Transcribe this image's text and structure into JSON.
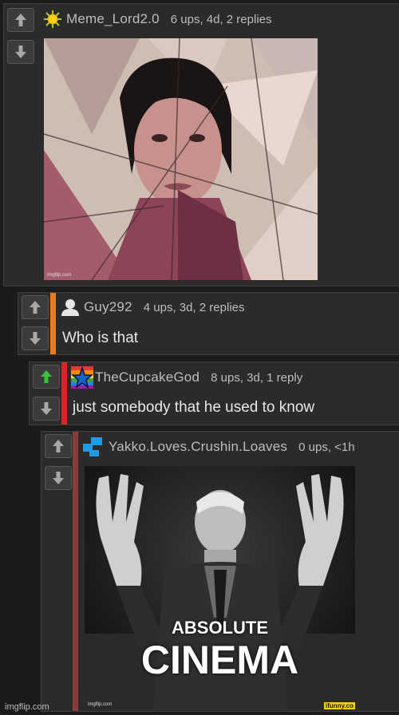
{
  "comments": [
    {
      "username": "Meme_Lord2.0",
      "meta": "6 ups, 4d, 2 replies",
      "avatar": "sun-icon",
      "image_watermark": "imgflip.com"
    },
    {
      "username": "Guy292",
      "meta": "4 ups, 3d, 2 replies",
      "text": "Who is that",
      "avatar": "user-silhouette-icon",
      "accent": "#f07b16"
    },
    {
      "username": "TheCupcakeGod",
      "meta": "8 ups, 3d, 1 reply",
      "text": "just somebody that he used to know",
      "avatar": "rainbow-star-icon",
      "accent": "#d62626",
      "upvoted": true
    },
    {
      "username": "Yakko.Loves.Crushin.Loaves",
      "meta": "0 ups, <1h",
      "avatar": "blue-pixel-icon",
      "accent": "#8a3b3b",
      "image_caption_top": "ABSOLUTE",
      "image_caption_bottom": "CINEMA",
      "image_watermark_left": "imgflip.com",
      "image_watermark_right": "ifunny.co"
    }
  ],
  "footer": "imgflip.com",
  "colors": {
    "upvote_active": "#3cbf3c",
    "vote_inactive": "#a8a8a8"
  }
}
